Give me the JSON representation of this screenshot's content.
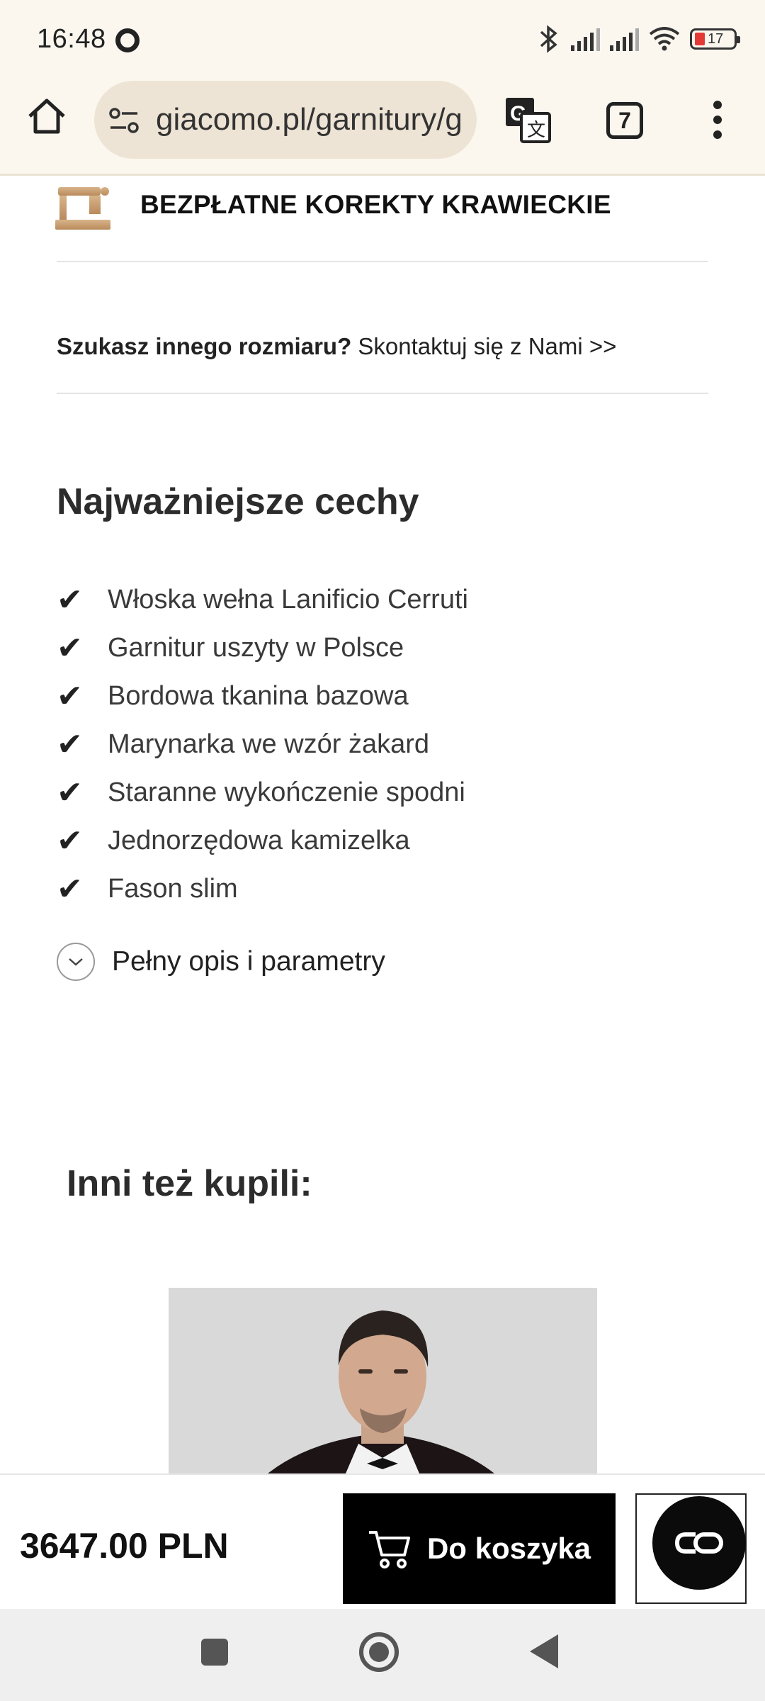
{
  "status_bar": {
    "time": "16:48",
    "battery_level": "17",
    "icons": [
      "record-icon",
      "bluetooth-icon",
      "signal-icon",
      "signal-icon",
      "wifi-icon",
      "battery-icon"
    ]
  },
  "browser": {
    "url": "giacomo.pl/garnitury/g",
    "tab_count": "7",
    "icons": [
      "home-icon",
      "site-settings-icon",
      "translate-icon",
      "more-vert-icon"
    ]
  },
  "page": {
    "tailoring_banner": "BEZPŁATNE KOREKTY KRAWIECKIE",
    "size_question": "Szukasz innego rozmiaru?",
    "size_contact": " Skontaktuj się z Nami >>",
    "features_heading": "Najważniejsze cechy",
    "check_glyph": "✔",
    "features": [
      "Włoska wełna Lanificio Cerruti",
      "Garnitur uszyty w Polsce",
      "Bordowa tkanina bazowa",
      "Marynarka we wzór żakard",
      "Staranne wykończenie spodni",
      "Jednorzędowa kamizelka",
      "Fason slim"
    ],
    "more_details": "Pełny opis i parametry",
    "others_heading": "Inni też kupili:"
  },
  "buy_bar": {
    "price": "3647.00 PLN",
    "cart_label": "Do koszyka",
    "colors": {
      "cart_bg": "#000000",
      "cart_text": "#ffffff"
    }
  },
  "colors": {
    "chrome_bg": "#fbf7ef",
    "url_pill": "#ede4d5",
    "accent_gold": "#c89a6a"
  }
}
